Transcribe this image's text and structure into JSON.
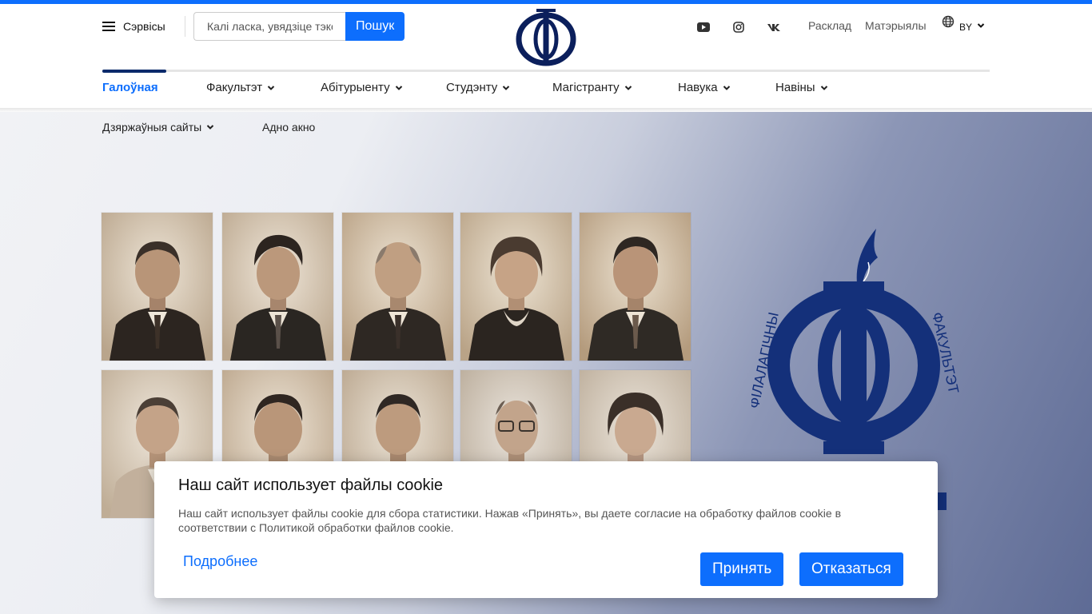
{
  "header": {
    "services_label": "Сэрвісы",
    "search": {
      "placeholder": "Калі ласка, увядзіце тэкст",
      "button_label": "Пошук"
    },
    "top_links": [
      "Расклад",
      "Матэрыялы"
    ],
    "language": "BY",
    "social": [
      "youtube-icon",
      "instagram-icon",
      "vk-icon"
    ]
  },
  "nav": {
    "items": [
      {
        "label": "Галоўная",
        "active": true
      },
      {
        "label": "Факультэт"
      },
      {
        "label": "Абітурыенту"
      },
      {
        "label": "Студэнту"
      },
      {
        "label": "Магістранту"
      },
      {
        "label": "Навука"
      },
      {
        "label": "Навіны"
      }
    ],
    "sub_items": [
      {
        "label": "Дзяржаўныя сайты"
      },
      {
        "label": "Адно акно"
      }
    ]
  },
  "emblem": {
    "left_text": "ФІЛАЛАГІЧНЫ",
    "right_text": "ФАКУЛЬТЭТ"
  },
  "cookie": {
    "title": "Наш сайт использует файлы cookie",
    "text": "Наш сайт использует файлы cookie для сбора статистики. Нажав «Принять», вы даете согласие на обработку файлов cookie в соответствии с Политикой обработки файлов cookie.",
    "more_label": "Подробнее",
    "accept_label": "Принять",
    "decline_label": "Отказаться"
  },
  "colors": {
    "accent": "#0d6efd",
    "brand_navy": "#14307a",
    "active_underline": "#0a2a6b"
  }
}
